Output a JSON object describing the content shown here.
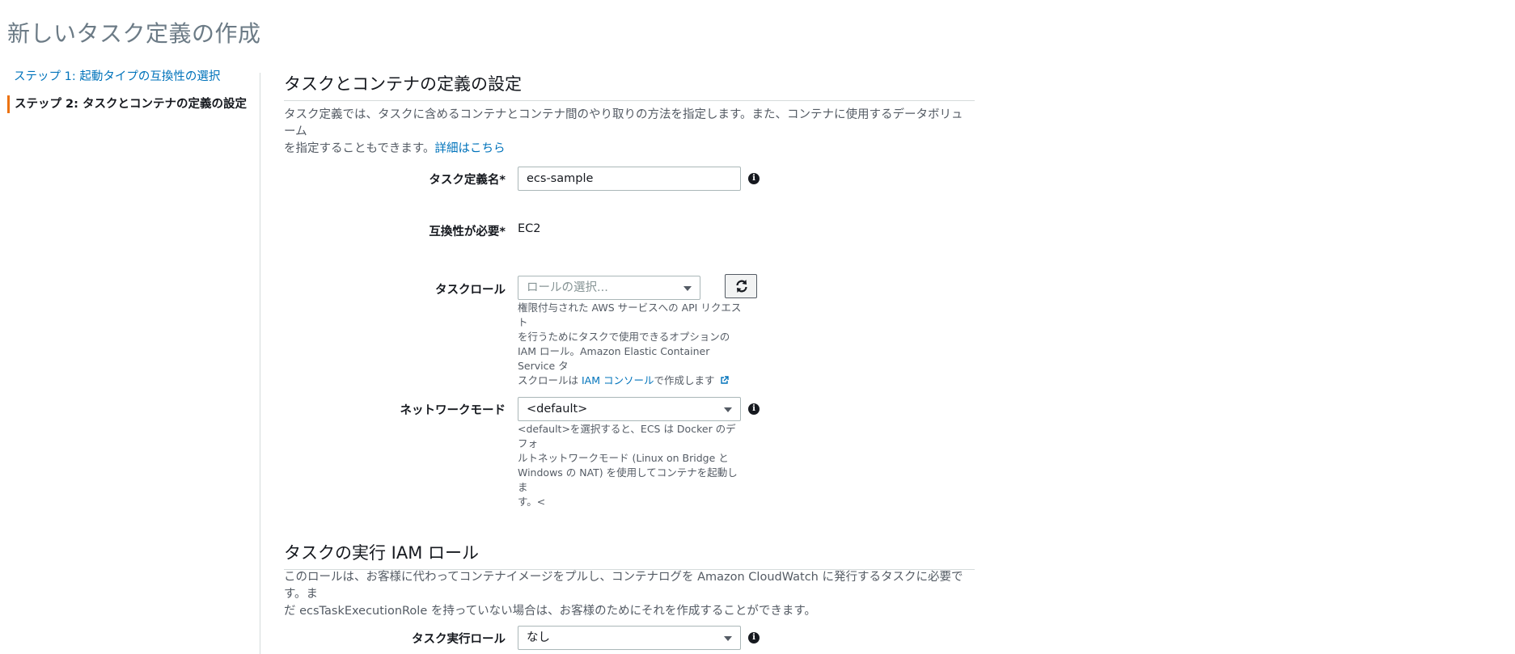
{
  "page_title": "新しいタスク定義の作成",
  "steps": {
    "step1_label": "ステップ 1: 起動タイプの互換性の選択",
    "step2_label": "ステップ 2: タスクとコンテナの定義の設定"
  },
  "section1": {
    "title": "タスクとコンテナの定義の設定",
    "desc_line1": "タスク定義では、タスクに含めるコンテナとコンテナ間のやり取りの方法を指定します。また、コンテナに使用するデータボリューム",
    "desc_line2": "を指定することもできます。",
    "learn_more": "詳細はこちら"
  },
  "task_def_name": {
    "label": "タスク定義名*",
    "value": "ecs-sample"
  },
  "compat": {
    "label": "互換性が必要*",
    "value": "EC2"
  },
  "task_role": {
    "label": "タスクロール",
    "placeholder": "ロールの選択...",
    "help_line1": "権限付与された AWS サービスへの API リクエスト",
    "help_line2": "を行うためにタスクで使用できるオプションの",
    "help_line3": "IAM ロール。Amazon Elastic Container Service タ",
    "help_line4_pre": "スクロールは ",
    "help_link": "IAM コンソール",
    "help_line4_post": "で作成します"
  },
  "network_mode": {
    "label": "ネットワークモード",
    "value": "<default>",
    "help_line1": "<default>を選択すると、ECS は Docker のデフォ",
    "help_line2": "ルトネットワークモード (Linux on Bridge と",
    "help_line3": "Windows の NAT) を使用してコンテナを起動しま",
    "help_line4": "す。<"
  },
  "section2": {
    "title": "タスクの実行 IAM ロール",
    "desc_line1": "このロールは、お客様に代わってコンテナイメージをプルし、コンテナログを Amazon CloudWatch に発行するタスクに必要です。ま",
    "desc_line2": "だ ecsTaskExecutionRole を持っていない場合は、お客様のためにそれを作成することができます。"
  },
  "exec_role": {
    "label": "タスク実行ロール",
    "value": "なし"
  },
  "icons": {
    "info": "info-icon",
    "refresh": "refresh-icon",
    "external": "external-link-icon",
    "caret": "caret-down-icon"
  }
}
